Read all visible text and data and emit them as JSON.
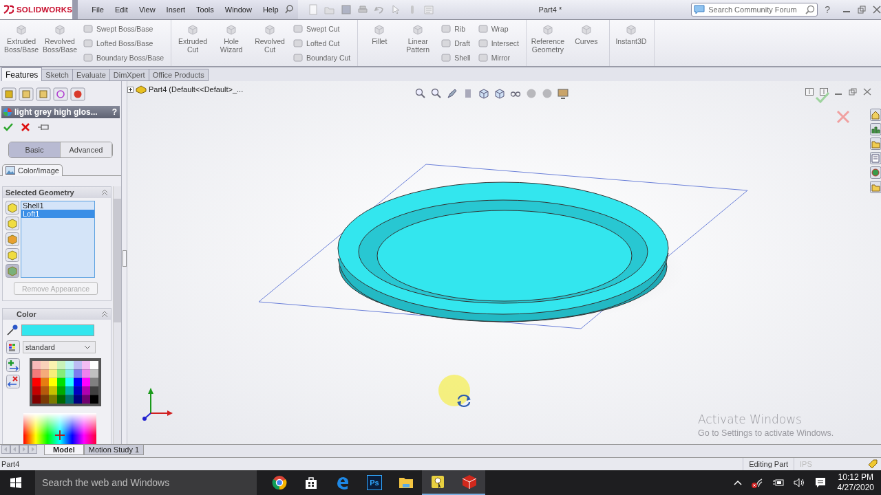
{
  "app": {
    "logo": "SOLIDWORKS",
    "menu": [
      "File",
      "Edit",
      "View",
      "Insert",
      "Tools",
      "Window",
      "Help"
    ],
    "document_title": "Part4 *",
    "search": {
      "placeholder": "Search Community Forum"
    },
    "help": "?"
  },
  "ribbon": [
    {
      "tools": [
        {
          "kind": "large",
          "label": "Extruded Boss/Base"
        },
        {
          "kind": "large",
          "label": "Revolved Boss/Base"
        },
        {
          "kind": "stack",
          "labels": [
            "Swept Boss/Base",
            "Lofted Boss/Base",
            "Boundary Boss/Base"
          ]
        }
      ]
    },
    {
      "tools": [
        {
          "kind": "large",
          "label": "Extruded Cut"
        },
        {
          "kind": "large",
          "label": "Hole Wizard"
        },
        {
          "kind": "large",
          "label": "Revolved Cut"
        },
        {
          "kind": "stack",
          "labels": [
            "Swept Cut",
            "Lofted Cut",
            "Boundary Cut"
          ]
        }
      ]
    },
    {
      "tools": [
        {
          "kind": "large",
          "label": "Fillet"
        },
        {
          "kind": "large",
          "label": "Linear Pattern"
        },
        {
          "kind": "stack",
          "labels": [
            "Rib",
            "Draft",
            "Shell"
          ]
        },
        {
          "kind": "stack",
          "labels": [
            "Wrap",
            "Intersect",
            "Mirror"
          ]
        }
      ]
    },
    {
      "tools": [
        {
          "kind": "large",
          "label": "Reference Geometry"
        },
        {
          "kind": "large",
          "label": "Curves"
        }
      ]
    },
    {
      "tools": [
        {
          "kind": "large",
          "label": "Instant3D"
        }
      ]
    }
  ],
  "tabs": [
    {
      "label": "Features",
      "selected": true
    },
    {
      "label": "Sketch",
      "selected": false
    },
    {
      "label": "Evaluate",
      "selected": false
    },
    {
      "label": "DimXpert",
      "selected": false
    },
    {
      "label": "Office Products",
      "selected": false
    }
  ],
  "property_manager": {
    "title": "light grey high glos...",
    "help": "?",
    "modes": [
      {
        "label": "Basic",
        "selected": true
      },
      {
        "label": "Advanced",
        "selected": false
      }
    ],
    "tab": "Color/Image",
    "selected_geometry": {
      "title": "Selected Geometry",
      "items": [
        {
          "label": "Shell1",
          "selected": false
        },
        {
          "label": "Loft1",
          "selected": true
        }
      ],
      "button": {
        "label": "Remove Appearance",
        "disabled": true
      }
    },
    "color": {
      "title": "Color",
      "palette": "standard"
    }
  },
  "feature_tree": {
    "root": "Part4",
    "config": "(Default<<Default>_..."
  },
  "notice": {
    "title": "Activate Windows",
    "text": "Go to Settings to activate Windows."
  },
  "bottom_tabs": [
    {
      "label": "Model",
      "selected": true
    },
    {
      "label": "Motion Study 1",
      "selected": false
    }
  ],
  "status_bar": {
    "document": "Part4",
    "mode": "Editing Part",
    "units": "IPS"
  },
  "taskbar": {
    "search": {
      "placeholder": "Search the web and Windows"
    },
    "apps": [
      {
        "kind": "chrome",
        "active": false
      },
      {
        "kind": "store",
        "active": false
      },
      {
        "kind": "edge",
        "active": false
      },
      {
        "kind": "photoshop",
        "label": "Ps",
        "active": false
      },
      {
        "kind": "explorer",
        "active": false
      },
      {
        "kind": "recorder",
        "active": true
      },
      {
        "kind": "solidworks",
        "active": true
      }
    ],
    "time": "10:12 PM",
    "date": "4/27/2020"
  }
}
